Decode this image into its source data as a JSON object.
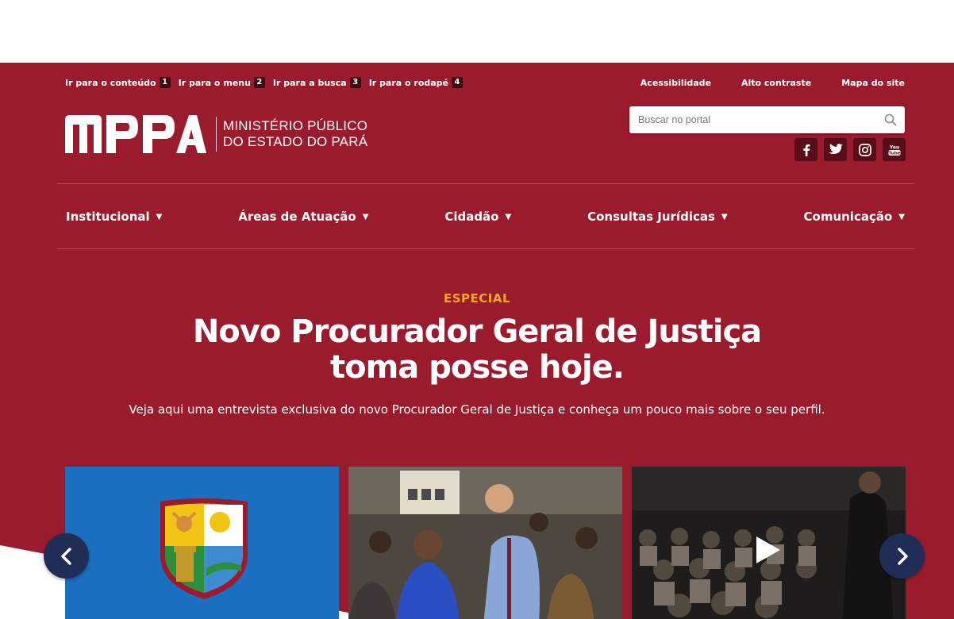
{
  "skip_links": [
    {
      "label": "Ir para o conteúdo",
      "key": "1"
    },
    {
      "label": "Ir para o menu",
      "key": "2"
    },
    {
      "label": "Ir para a busca",
      "key": "3"
    },
    {
      "label": "Ir para o rodapé",
      "key": "4"
    }
  ],
  "utility_links": [
    "Acessibilidade",
    "Alto contraste",
    "Mapa do site"
  ],
  "logo": {
    "acronym": "MPPA",
    "line1": "MINISTÉRIO PÚBLICO",
    "line2": "DO ESTADO DO PARÁ"
  },
  "search": {
    "placeholder": "Buscar no portal"
  },
  "social": [
    "facebook-icon",
    "twitter-icon",
    "instagram-icon",
    "youtube-icon"
  ],
  "nav": [
    {
      "label": "Institucional"
    },
    {
      "label": "Áreas de Atuação"
    },
    {
      "label": "Cidadão"
    },
    {
      "label": "Consultas Jurídicas"
    },
    {
      "label": "Comunicação"
    }
  ],
  "hero": {
    "kicker": "ESPECIAL",
    "title_line1": "Novo Procurador Geral de Justiça",
    "title_line2": "toma posse hoje.",
    "subtitle": "Veja aqui uma entrevista exclusiva do novo Procurador Geral de Justiça e conheça um pouco mais sobre o seu perfil."
  },
  "colors": {
    "brand": "#9a1b2e",
    "accent": "#f6a623",
    "nav_arrow": "#1f2d57",
    "card_blue": "#1a6fc0"
  }
}
